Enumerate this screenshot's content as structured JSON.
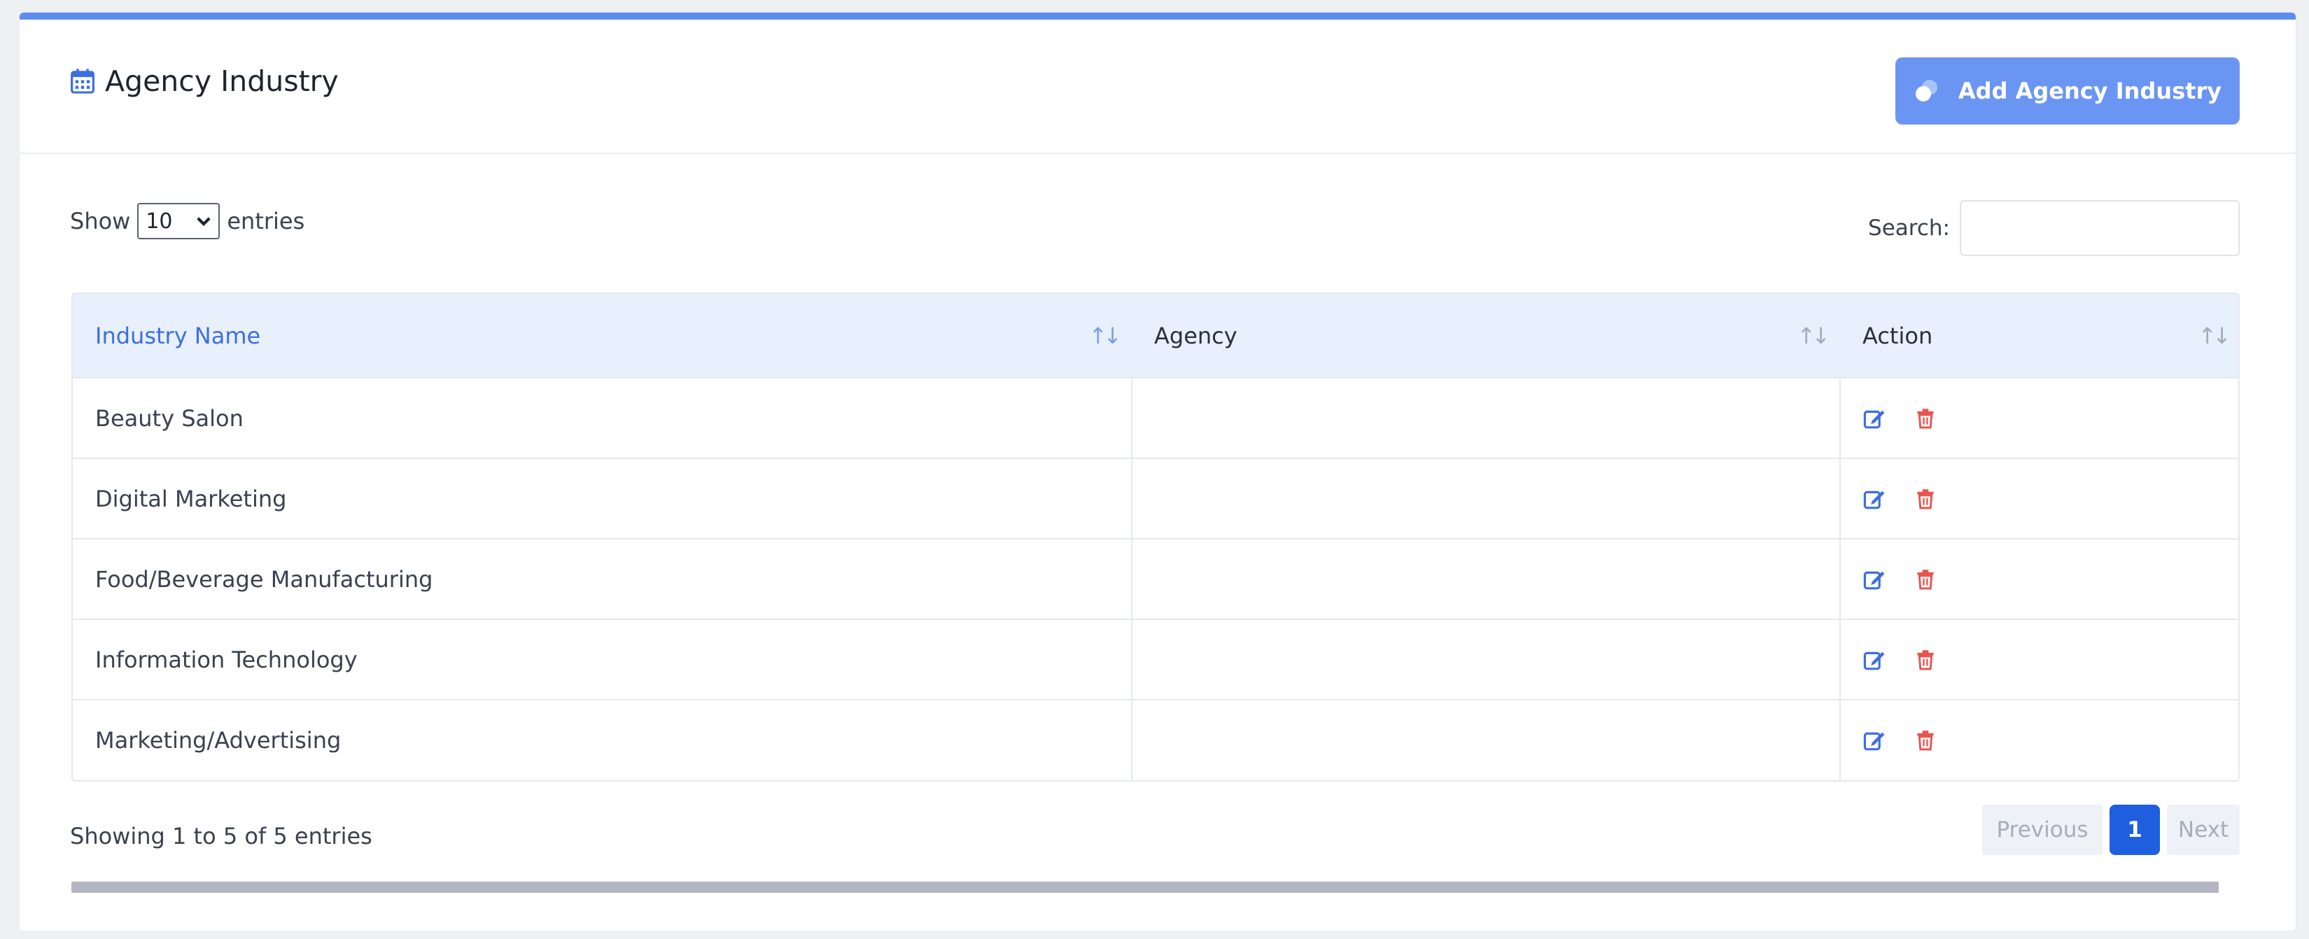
{
  "header": {
    "title": "Agency Industry",
    "add_button_label": "Add Agency Industry"
  },
  "controls": {
    "show_label": "Show",
    "entries_label": "entries",
    "page_length": "10",
    "search_label": "Search:",
    "search_value": ""
  },
  "table": {
    "columns": [
      "Industry Name",
      "Agency",
      "Action"
    ],
    "rows": [
      {
        "industry": "Beauty Salon",
        "agency": ""
      },
      {
        "industry": "Digital Marketing",
        "agency": ""
      },
      {
        "industry": "Food/Beverage Manufacturing",
        "agency": ""
      },
      {
        "industry": "Information Technology",
        "agency": ""
      },
      {
        "industry": "Marketing/Advertising",
        "agency": ""
      }
    ]
  },
  "footer": {
    "info": "Showing 1 to 5 of 5 entries",
    "previous_label": "Previous",
    "current_page": "1",
    "next_label": "Next"
  },
  "icons": {
    "title": "calendar-icon",
    "add_button": "toggle-icon",
    "sort": "sort-arrows-icon",
    "edit": "edit-icon",
    "delete": "trash-icon",
    "dropdown": "chevron-down-icon"
  },
  "colors": {
    "accent": "#5b8def",
    "button": "#6b95f2",
    "header_row": "#e8f0fd",
    "sorted_column": "#3c6fe0",
    "edit_icon": "#3c6fe0",
    "delete_icon": "#e8554e",
    "current_page": "#1f5fdf"
  }
}
